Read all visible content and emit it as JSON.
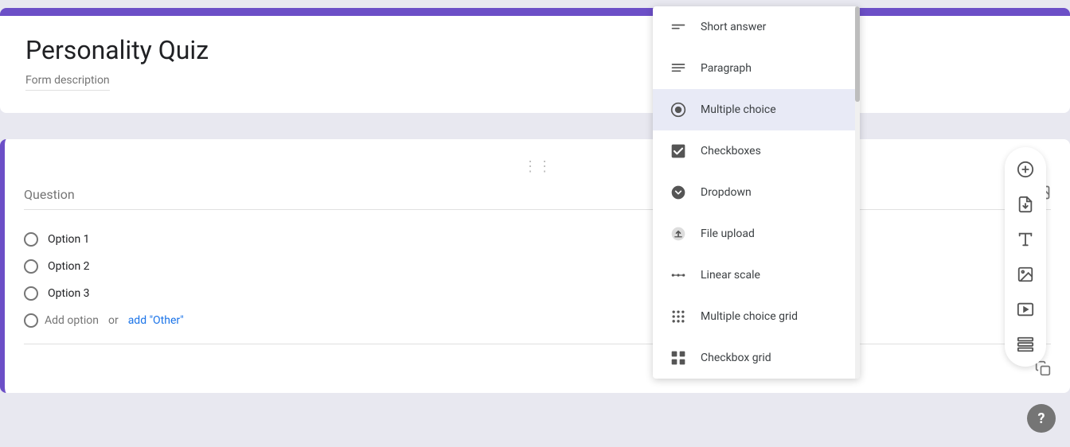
{
  "page": {
    "background_color": "#e8e8f0"
  },
  "header": {
    "title": "Personality Quiz",
    "description": "Form description",
    "border_color": "#6c4fc7"
  },
  "question_card": {
    "placeholder": "Question",
    "options": [
      {
        "label": "Option 1"
      },
      {
        "label": "Option 2"
      },
      {
        "label": "Option 3"
      }
    ],
    "add_option_text": "Add option",
    "add_option_connector": "or",
    "add_other_text": "add \"Other\""
  },
  "dropdown_menu": {
    "items": [
      {
        "id": "short-answer",
        "label": "Short answer",
        "icon": "short-answer"
      },
      {
        "id": "paragraph",
        "label": "Paragraph",
        "icon": "paragraph"
      },
      {
        "id": "multiple-choice",
        "label": "Multiple choice",
        "icon": "multiple-choice",
        "selected": true
      },
      {
        "id": "checkboxes",
        "label": "Checkboxes",
        "icon": "checkboxes"
      },
      {
        "id": "dropdown",
        "label": "Dropdown",
        "icon": "dropdown"
      },
      {
        "id": "file-upload",
        "label": "File upload",
        "icon": "file-upload"
      },
      {
        "id": "linear-scale",
        "label": "Linear scale",
        "icon": "linear-scale"
      },
      {
        "id": "multiple-choice-grid",
        "label": "Multiple choice grid",
        "icon": "multiple-choice-grid"
      },
      {
        "id": "checkbox-grid",
        "label": "Checkbox grid",
        "icon": "checkbox-grid"
      }
    ]
  },
  "toolbar": {
    "buttons": [
      {
        "id": "add-question",
        "icon": "plus-circle",
        "label": "Add question"
      },
      {
        "id": "import-questions",
        "icon": "import",
        "label": "Import questions"
      },
      {
        "id": "add-title",
        "icon": "title",
        "label": "Add title and description"
      },
      {
        "id": "add-image",
        "icon": "image",
        "label": "Add image"
      },
      {
        "id": "add-video",
        "icon": "video",
        "label": "Add video"
      },
      {
        "id": "add-section",
        "icon": "section",
        "label": "Add section"
      }
    ]
  },
  "help": {
    "label": "?"
  }
}
